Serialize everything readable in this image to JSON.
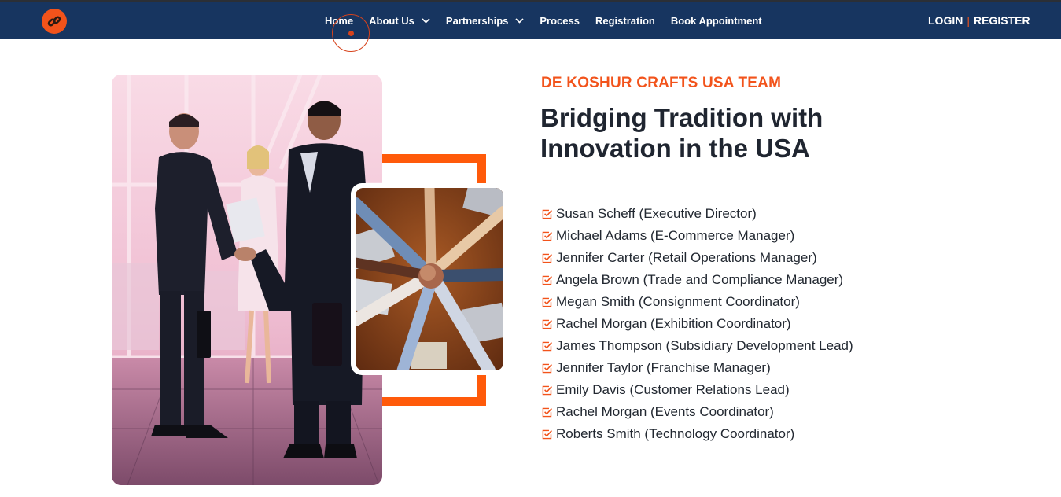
{
  "nav": {
    "logo_icon": "link-chain-icon",
    "items": [
      {
        "label": "Home",
        "has_dropdown": false
      },
      {
        "label": "About Us",
        "has_dropdown": true
      },
      {
        "label": "Partnerships",
        "has_dropdown": true
      },
      {
        "label": "Process",
        "has_dropdown": false
      },
      {
        "label": "Registration",
        "has_dropdown": false
      },
      {
        "label": "Book Appointment",
        "has_dropdown": false
      }
    ],
    "login": "LOGIN",
    "separator": "|",
    "register": "REGISTER"
  },
  "section": {
    "eyebrow": "DE KOSHUR CRAFTS USA TEAM",
    "heading": "Bridging Tradition with Innovation in the USA",
    "members": [
      "Susan Scheff (Executive Director)",
      "Michael Adams (E-Commerce Manager)",
      "Jennifer Carter (Retail Operations Manager)",
      "Angela Brown (Trade and Compliance Manager)",
      "Megan Smith (Consignment Coordinator)",
      "Rachel Morgan (Exhibition Coordinator)",
      "James Thompson (Subsidiary Development Lead)",
      "Jennifer Taylor (Franchise Manager)",
      "Emily Davis (Customer Relations Lead)",
      "Rachel Morgan (Events Coordinator)",
      "Roberts Smith (Technology Coordinator)"
    ]
  },
  "images": {
    "hero": "business-handshake-photo",
    "inset": "team-hands-stacked-photo"
  },
  "colors": {
    "navbar": "#173560",
    "accent": "#f2531b",
    "frame": "#ff5a0a",
    "heading": "#1f2530"
  }
}
